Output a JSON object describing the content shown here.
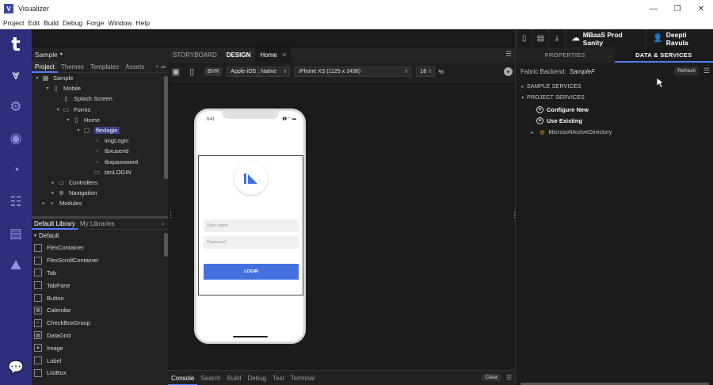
{
  "app": {
    "title": "Visualizer",
    "icon_letter": "V"
  },
  "window_controls": [
    "—",
    "❐",
    "✕"
  ],
  "menu": [
    "Project",
    "Edit",
    "Build",
    "Debug",
    "Forge",
    "Window",
    "Help"
  ],
  "topbar": {
    "env_label": "MBaaS Prod Sanity",
    "user_label": "Deepti Ravula"
  },
  "rail": {
    "logo": "t"
  },
  "project_panel": {
    "project_selector": "Sample",
    "tabs": [
      "Project",
      "Themes",
      "Templates",
      "Assets"
    ],
    "tree": [
      {
        "label": "Sample",
        "indent": 0,
        "caret": "▾"
      },
      {
        "label": "Mobile",
        "indent": 1,
        "caret": "▾"
      },
      {
        "label": "Splash Screen",
        "indent": 2,
        "caret": ""
      },
      {
        "label": "Forms",
        "indent": 2,
        "caret": "▾"
      },
      {
        "label": "Home",
        "indent": 3,
        "caret": "▾"
      },
      {
        "label": "flexlogin",
        "indent": 4,
        "caret": "▾",
        "selected": true
      },
      {
        "label": "imgLogin",
        "indent": 5,
        "caret": ""
      },
      {
        "label": "tbxuserid",
        "indent": 5,
        "caret": ""
      },
      {
        "label": "tbxpassword",
        "indent": 5,
        "caret": ""
      },
      {
        "label": "btnLOGIN",
        "indent": 5,
        "caret": ""
      },
      {
        "label": "Controllers",
        "indent": 2,
        "caret": "▸"
      },
      {
        "label": "Navigation",
        "indent": 2,
        "caret": "▸"
      },
      {
        "label": "Modules",
        "indent": 1,
        "caret": "▸"
      }
    ]
  },
  "library": {
    "tabs": [
      "Default Library",
      "My Libraries"
    ],
    "group": "Default",
    "items": [
      "FlexContainer",
      "FlexScrollContainer",
      "Tab",
      "TabPane",
      "Button",
      "Calendar",
      "CheckBoxGroup",
      "DataGrid",
      "Image",
      "Label",
      "ListBox"
    ]
  },
  "editor": {
    "tabs": {
      "storyboard": "STORYBOARD",
      "design": "DESIGN",
      "home": "Home"
    },
    "bvr": "BVR",
    "platform": "Apple-iOS : Native",
    "device": "iPhone XS (1125 x 2436)",
    "zoom": "18",
    "zoom_unit": "%"
  },
  "phone": {
    "time": "9:41",
    "username_placeholder": "User name",
    "password_placeholder": "Password",
    "login_label": "LOGIN"
  },
  "console": {
    "tabs": [
      "Console",
      "Search",
      "Build",
      "Debug",
      "Test",
      "Terminal"
    ],
    "clear_label": "Clear"
  },
  "right_panel": {
    "tabs": {
      "properties": "PROPERTIES",
      "data": "DATA & SERVICES"
    },
    "fabric_label": "Fabric Backend:",
    "fabric_value": "SampleF",
    "refresh_label": "Refresh",
    "sample_services": "SAMPLE SERVICES",
    "project_services": "PROJECT SERVICES",
    "configure_new": "Configure New",
    "use_existing": "Use Existing",
    "service_item": "MicrosoftActiveDirectory"
  }
}
